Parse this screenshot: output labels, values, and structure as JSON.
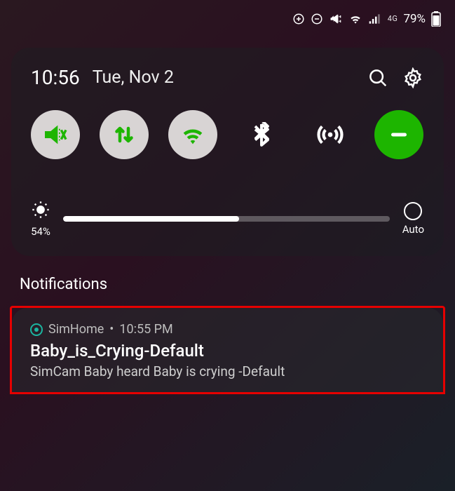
{
  "statusbar": {
    "network": "4G",
    "battery_pct": "79%"
  },
  "panel": {
    "time": "10:56",
    "date": "Tue, Nov 2",
    "brightness_pct": "54%",
    "brightness_value": 54,
    "auto_label": "Auto",
    "toggles": [
      {
        "name": "mute",
        "active": true
      },
      {
        "name": "data-sync",
        "active": true
      },
      {
        "name": "wifi",
        "active": true
      },
      {
        "name": "bluetooth",
        "active": false
      },
      {
        "name": "hotspot",
        "active": false
      },
      {
        "name": "dnd",
        "active": true
      }
    ]
  },
  "notifications": {
    "header": "Notifications",
    "items": [
      {
        "app": "SimHome",
        "time": "10:55 PM",
        "separator": "•",
        "title": "Baby_is_Crying-Default",
        "body": "SimCam Baby heard Baby is crying -Default"
      }
    ]
  },
  "colors": {
    "toggle_active_bg": "#d8d4d4",
    "toggle_active_icon": "#1db500",
    "highlight": "#e60000"
  }
}
